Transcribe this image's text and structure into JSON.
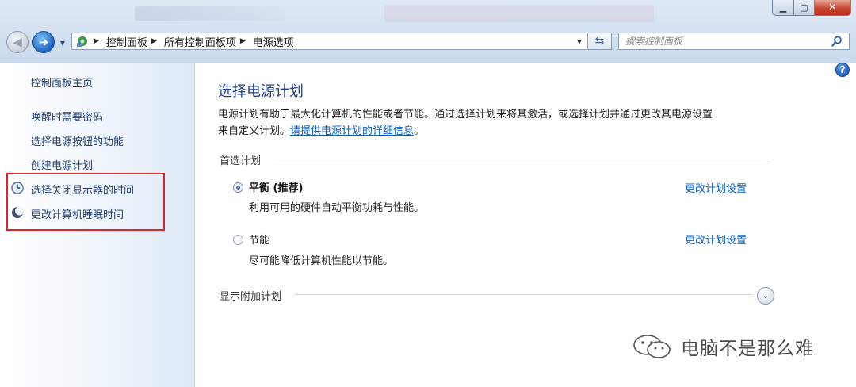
{
  "window": {
    "minimize_glyph": "▁",
    "maximize_glyph": "▢",
    "close_glyph": "✕"
  },
  "nav": {
    "back_glyph": "◀",
    "forward_glyph": "➜",
    "dropdown_glyph": "▼"
  },
  "address": {
    "breadcrumbs": [
      "控制面板",
      "所有控制面板项",
      "电源选项"
    ],
    "separator": "▶",
    "dropdown_glyph": "▼",
    "refresh_glyph": "⇆"
  },
  "search": {
    "placeholder": "搜索控制面板"
  },
  "sidebar": {
    "home": "控制面板主页",
    "links": [
      "唤醒时需要密码",
      "选择电源按钮的功能",
      "创建电源计划",
      "选择关闭显示器的时间",
      "更改计算机睡眠时间"
    ]
  },
  "main": {
    "help_glyph": "?",
    "title": "选择电源计划",
    "description_line1": "电源计划有助于最大化计算机的性能或者节能。通过选择计划来将其激活，或选择计划并通过更改其电源设置",
    "description_line2_prefix": "来自定义计划。",
    "description_link": "请提供电源计划的详细信息",
    "description_suffix": "。",
    "preferred_group": "首选计划",
    "plans": [
      {
        "name": "平衡 (推荐)",
        "description": "利用可用的硬件自动平衡功耗与性能。",
        "link": "更改计划设置",
        "selected": true
      },
      {
        "name": "节能",
        "description": "尽可能降低计算机性能以节能。",
        "link": "更改计划设置",
        "selected": false
      }
    ],
    "show_additional": "显示附加计划",
    "expand_glyph": "⌄"
  },
  "watermark": {
    "text": "电脑不是那么难"
  },
  "colors": {
    "link": "#0a5fc7",
    "title": "#1e3e8a",
    "highlight_box": "#e0232a"
  }
}
